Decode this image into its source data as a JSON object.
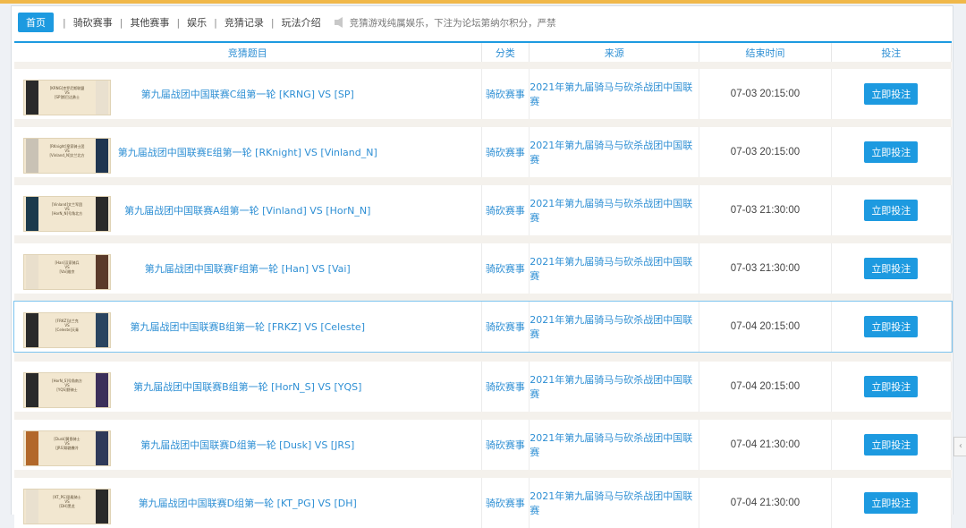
{
  "nav": {
    "tabs": [
      "首页",
      "骑砍赛事",
      "其他赛事",
      "娱乐",
      "竞猜记录",
      "玩法介绍"
    ],
    "separator": "|",
    "notice": "竞猜游戏纯属娱乐，下注为论坛第纳尔积分，严禁"
  },
  "table": {
    "headers": [
      "竞猜题目",
      "分类",
      "来源",
      "结束时间",
      "投注"
    ],
    "rows": [
      {
        "title": "第九届战团中国联赛C组第一轮 [KRNG] VS [SP]",
        "category": "骑砍赛事",
        "source": "2021年第九届骑马与砍杀战团中国联赛",
        "end_time": "07-03 20:15:00",
        "button": "立即投注",
        "banner": [
          "[KRNG]克罗尼斯联盟",
          "VS",
          "[SP]斯巴达勇士"
        ],
        "flag_left": "#2a2a2a",
        "flag_right": "#e9e0cf"
      },
      {
        "title": "第九届战团中国联赛E组第一轮 [RKnight] VS [Vinland_N]",
        "category": "骑砍赛事",
        "source": "2021年第九届骑马与砍杀战团中国联赛",
        "end_time": "07-03 20:15:00",
        "button": "立即投注",
        "banner": [
          "[RKnight]皇家骑士团",
          "VS",
          "[Vinland_N]文兰北方"
        ],
        "flag_left": "#c9c2b5",
        "flag_right": "#1f3550"
      },
      {
        "title": "第九届战团中国联赛A组第一轮 [Vinland] VS [HorN_N]",
        "category": "骑砍赛事",
        "source": "2021年第九届骑马与砍杀战团中国联赛",
        "end_time": "07-03 21:30:00",
        "button": "立即投注",
        "banner": [
          "[Vinland]文兰军团",
          "VS",
          "[HorN_N]号角北方"
        ],
        "flag_left": "#1c3a4c",
        "flag_right": "#2a2a2a"
      },
      {
        "title": "第九届战团中国联赛F组第一轮 [Han] VS [Vai]",
        "category": "骑砍赛事",
        "source": "2021年第九届骑马与砍杀战团中国联赛",
        "end_time": "07-03 21:30:00",
        "button": "立即投注",
        "banner": [
          "[Han]汉家骑兵",
          "VS",
          "[Vai]维京"
        ],
        "flag_left": "#e9dfcc",
        "flag_right": "#5a3a2a"
      },
      {
        "title": "第九届战团中国联赛B组第一轮 [FRKZ] VS [Celeste]",
        "category": "骑砍赛事",
        "source": "2021年第九届骑马与砍杀战团中国联赛",
        "end_time": "07-04 20:15:00",
        "button": "立即投注",
        "banner": [
          "[FRKZ]法兰克",
          "VS",
          "[Celeste]天青"
        ],
        "flag_left": "#2a2a2a",
        "flag_right": "#2a4460"
      },
      {
        "title": "第九届战团中国联赛B组第一轮 [HorN_S] VS [YQS]",
        "category": "骑砍赛事",
        "source": "2021年第九届骑马与砍杀战团中国联赛",
        "end_time": "07-04 20:15:00",
        "button": "立即投注",
        "banner": [
          "[HorN_S]号角南方",
          "VS",
          "[YQS]野骑士"
        ],
        "flag_left": "#2a2a2a",
        "flag_right": "#3c2f5a"
      },
      {
        "title": "第九届战团中国联赛D组第一轮 [Dusk] VS [JRS]",
        "category": "骑砍赛事",
        "source": "2021年第九届骑马与砍杀战团中国联赛",
        "end_time": "07-04 21:30:00",
        "button": "立即投注",
        "banner": [
          "[Dusk]黄昏骑士",
          "VS",
          "[JRS]耶路撒冷"
        ],
        "flag_left": "#b2682a",
        "flag_right": "#2f3a5a"
      },
      {
        "title": "第九届战团中国联赛D组第一轮 [KT_PG] VS [DH]",
        "category": "骑砍赛事",
        "source": "2021年第九届骑马与砍杀战团中国联赛",
        "end_time": "07-04 21:30:00",
        "button": "立即投注",
        "banner": [
          "[KT_PG]圣殿骑士",
          "VS",
          "[DH]黑龙"
        ],
        "flag_left": "#e9e0cf",
        "flag_right": "#2a2a2a"
      }
    ]
  },
  "colors": {
    "accent": "#1d9ae0",
    "link": "#2e8fd4"
  },
  "side_button_icon": "collapse-icon"
}
